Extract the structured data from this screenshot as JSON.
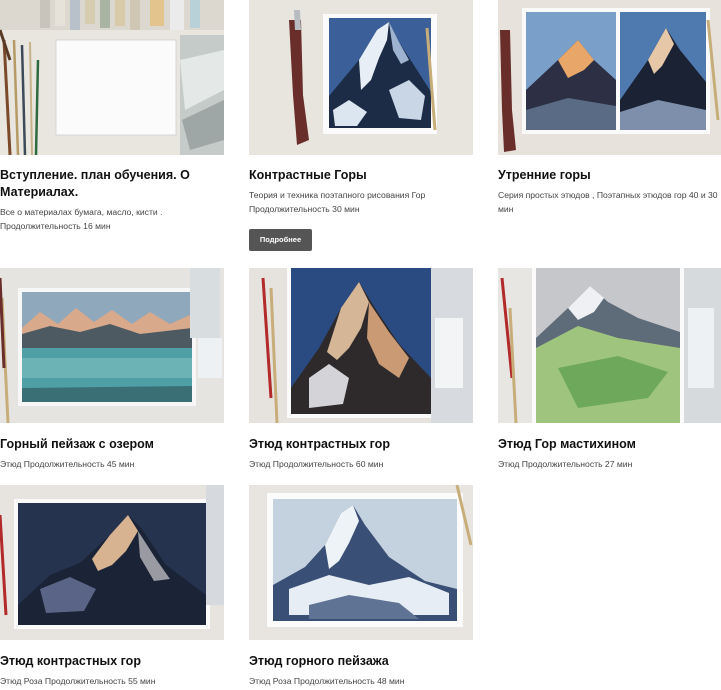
{
  "courses": [
    {
      "title": "Вступление. план обучения. О Материалах.",
      "desc": "Все о материалах бумага, масло, кисти . Продолжительность 16 мин"
    },
    {
      "title": "Контрастные Горы",
      "desc": "Теория и техника поэтапного рисования Гор Продолжительность 30 мин",
      "button": "Подробнее"
    },
    {
      "title": "Утренние горы",
      "desc": "Серия простых этюдов , Поэтапных этюдов гор 40 и 30 мин"
    },
    {
      "title": "Горный пейзаж с озером",
      "desc": "Этюд Продолжительность 45 мин"
    },
    {
      "title": "Этюд контрастных гор",
      "desc": "Этюд Продолжительность 60 мин"
    },
    {
      "title": "Этюд Гор мастихином",
      "desc": "Этюд Продолжительность 27 мин"
    },
    {
      "title": "Этюд контрастных гор",
      "desc": "Этюд Роза Продолжительность 55 мин"
    },
    {
      "title": "Этюд горного пейзажа",
      "desc": "Этюд Роза Продолжительность 48 мин"
    }
  ]
}
